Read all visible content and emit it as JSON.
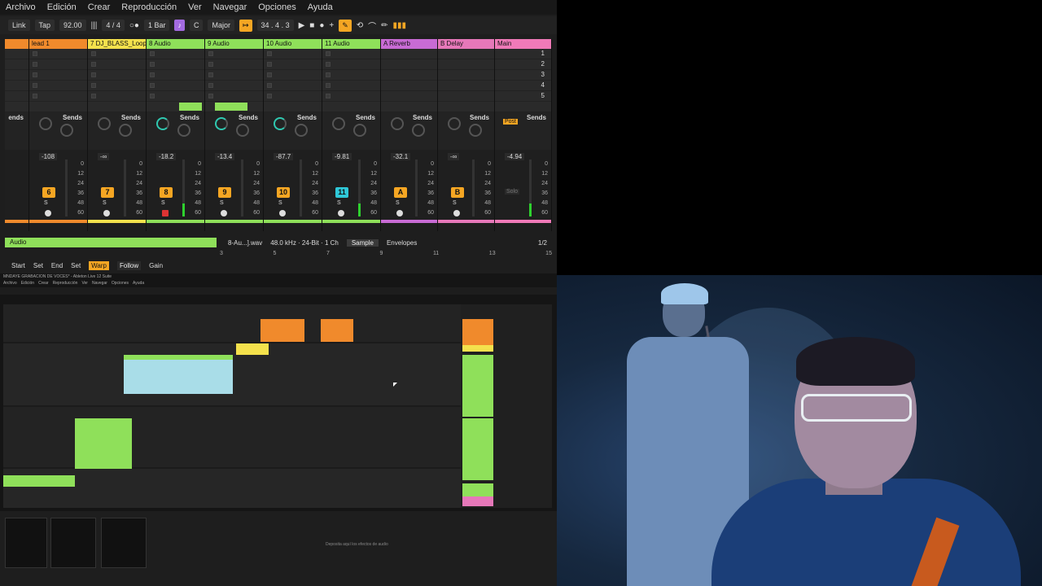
{
  "menu": [
    "Archivo",
    "Edición",
    "Crear",
    "Reproducción",
    "Ver",
    "Navegar",
    "Opciones",
    "Ayuda"
  ],
  "toolbar": {
    "link": "Link",
    "tap": "Tap",
    "tempo": "92.00",
    "signature": "4 / 4",
    "quantize": "1 Bar",
    "key": "C",
    "scale": "Major",
    "position": "34 .   4 .   3"
  },
  "tracks": [
    {
      "name": "",
      "color": "#f08a2c",
      "number": "",
      "volume": "",
      "sends": "ends"
    },
    {
      "name": "lead 1",
      "color": "#f08a2c",
      "number": "6",
      "volume": "-108",
      "sends": "Sends"
    },
    {
      "name": "7 DJ_BLASS_Loop",
      "color": "#f4e14c",
      "number": "7",
      "volume": "-∞",
      "sends": "Sends"
    },
    {
      "name": "8 Audio",
      "color": "#8fe05a",
      "number": "8",
      "volume": "-18.2",
      "sends": "Sends"
    },
    {
      "name": "9 Audio",
      "color": "#8fe05a",
      "number": "9",
      "volume": "-13.4",
      "sends": "Sends"
    },
    {
      "name": "10 Audio",
      "color": "#8fe05a",
      "number": "10",
      "volume": "-87.7",
      "sends": "Sends"
    },
    {
      "name": "11 Audio",
      "color": "#8fe05a",
      "number": "11",
      "volume": "-9.81",
      "sends": "Sends"
    },
    {
      "name": "A Reverb",
      "color": "#c86bd4",
      "number": "A",
      "volume": "-32.1",
      "sends": "Sends"
    },
    {
      "name": "B Delay",
      "color": "#e678b9",
      "number": "B",
      "volume": "-∞",
      "sends": "Sends"
    },
    {
      "name": "Main",
      "color": "#f07ab8",
      "number": "",
      "volume": "-4.94",
      "sends": "Sends"
    }
  ],
  "scenes": [
    "1",
    "2",
    "3",
    "4",
    "5"
  ],
  "post": "Post",
  "solo": "Solo",
  "db_scale": [
    "0",
    "12",
    "24",
    "36",
    "48",
    "60"
  ],
  "clip": {
    "name": "Audio",
    "file": "8-Au...].wav",
    "info": "48.0 kHz · 24-Bit · 1 Ch",
    "tab_sample": "Sample",
    "tab_envelopes": "Envelopes",
    "page": "1/2",
    "start": "Start",
    "set1": "Set",
    "end": "End",
    "set2": "Set",
    "warp": "Warp",
    "follow": "Follow",
    "gain": "Gain",
    "ruler": [
      "3",
      "5",
      "7",
      "9",
      "11",
      "13",
      "15"
    ]
  },
  "arrangement": {
    "title": "MNDAYE GRABACION DE VOCES* - Ableton Live 12 Suite",
    "drop_hint": "Deposita aquí los efectos de audio"
  }
}
